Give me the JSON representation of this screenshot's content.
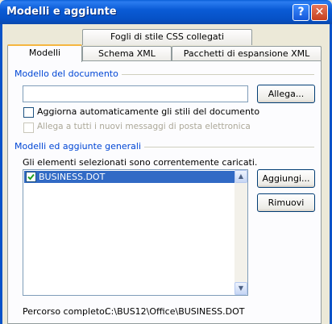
{
  "window": {
    "title": "Modelli e aggiunte",
    "help_glyph": "?",
    "close_glyph": "✕"
  },
  "tabs": {
    "top_row": [
      "Fogli di stile CSS collegati"
    ],
    "bottom_row": [
      "Modelli",
      "Schema XML",
      "Pacchetti di espansione XML"
    ],
    "active": "Modelli"
  },
  "document_template": {
    "group_label": "Modello del documento",
    "path_value": "",
    "attach_button": "Allega...",
    "auto_update_label": "Aggiorna automaticamente gli stili del documento",
    "auto_update_checked": false,
    "attach_all_label": "Allega a tutti i nuovi messaggi di posta elettronica",
    "attach_all_checked": false
  },
  "global_templates": {
    "group_label": "Modelli ed aggiunte generali",
    "description": "Gli elementi selezionati sono correntemente caricati.",
    "items": [
      {
        "name": "BUSINESS.DOT",
        "checked": true,
        "selected": true
      }
    ],
    "add_button": "Aggiungi...",
    "remove_button": "Rimuovi",
    "full_path_label": "Percorso completo:",
    "full_path_value": "C:\\BUS12\\Office\\BUSINESS.DOT"
  }
}
